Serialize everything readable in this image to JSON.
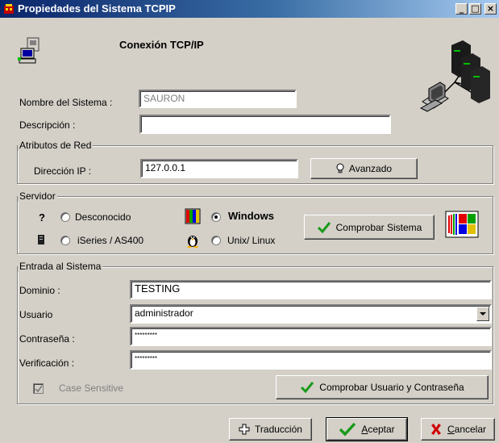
{
  "window": {
    "title": "Propiedades del Sistema TCPIP",
    "minimize": "_",
    "maximize": "□",
    "close": "×"
  },
  "header": {
    "title": "Conexión TCP/IP"
  },
  "system": {
    "name_label": "Nombre del Sistema :",
    "name_value": "SAURON",
    "desc_label": "Descripción :",
    "desc_value": ""
  },
  "network": {
    "group_label": "Atributos de Red",
    "ip_label": "Dirección IP :",
    "ip_value": "127.0.0.1",
    "advanced_button": "Avanzado"
  },
  "server": {
    "group_label": "Servidor",
    "unknown_icon_glyph": "?",
    "options": {
      "unknown": "Desconocido",
      "windows": "Windows",
      "iseries": "iSeries / AS400",
      "unix": "Unix/ Linux"
    },
    "selected": "windows",
    "check_button": "Comprobar Sistema"
  },
  "login": {
    "group_label": "Entrada al Sistema",
    "domain_label": "Dominio :",
    "domain_value": "TESTING",
    "user_label": "Usuario",
    "user_value": "administrador",
    "password_label": "Contraseña :",
    "password_value": "*********",
    "verify_label": "Verificación :",
    "verify_value": "*********",
    "case_sensitive_label": "Case Sensitive",
    "check_button": "Comprobar Usuario y Contraseña"
  },
  "footer": {
    "translate_button": "Traducción",
    "accept_button_prefix": "A",
    "accept_button_rest": "ceptar",
    "cancel_button_prefix": "C",
    "cancel_button_rest": "ancelar"
  },
  "colors": {
    "titlebar_start": "#0a246a",
    "titlebar_end": "#a6caf0",
    "face": "#d4d0c8",
    "check_green": "#1a9a1a",
    "cancel_red": "#d00000"
  }
}
